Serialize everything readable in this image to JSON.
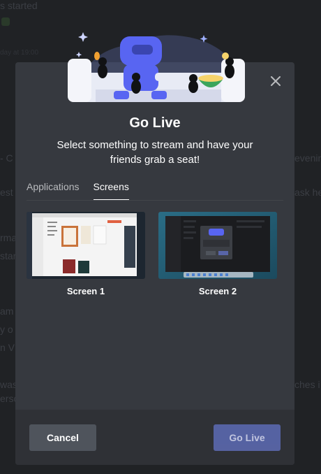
{
  "background": {
    "lines": [
      "s started",
      "day at 19:00",
      "- C",
      "evening",
      "est",
      "ask he",
      "rma",
      "star",
      "am",
      "y o",
      "n V",
      "was",
      "ches i",
      "erso"
    ]
  },
  "modal": {
    "title": "Go Live",
    "subtitle": "Select something to stream and have your friends grab a seat!",
    "tabs": [
      {
        "label": "Applications",
        "active": false
      },
      {
        "label": "Screens",
        "active": true
      }
    ],
    "screens": [
      {
        "label": "Screen 1"
      },
      {
        "label": "Screen 2"
      }
    ],
    "footer": {
      "cancel_label": "Cancel",
      "golive_label": "Go Live"
    }
  },
  "colors": {
    "modal_bg": "#36393f",
    "footer_bg": "#2f3136",
    "cancel_bg": "#4f545c",
    "golive_bg": "#5865a8",
    "brand": "#5865f2"
  },
  "icons": [
    "close-icon"
  ]
}
